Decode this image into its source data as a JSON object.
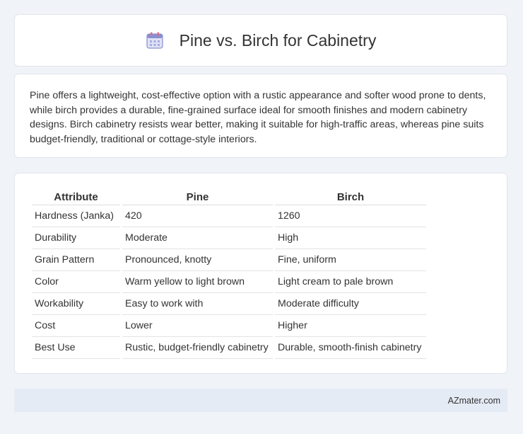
{
  "header": {
    "title": "Pine vs. Birch for Cabinetry",
    "icon": "calendar-icon"
  },
  "description": "Pine offers a lightweight, cost-effective option with a rustic appearance and softer wood prone to dents, while birch provides a durable, fine-grained surface ideal for smooth finishes and modern cabinetry designs. Birch cabinetry resists wear better, making it suitable for high-traffic areas, whereas pine suits budget-friendly, traditional or cottage-style interiors.",
  "table": {
    "headers": [
      "Attribute",
      "Pine",
      "Birch"
    ],
    "rows": [
      [
        "Hardness (Janka)",
        "420",
        "1260"
      ],
      [
        "Durability",
        "Moderate",
        "High"
      ],
      [
        "Grain Pattern",
        "Pronounced, knotty",
        "Fine, uniform"
      ],
      [
        "Color",
        "Warm yellow to light brown",
        "Light cream to pale brown"
      ],
      [
        "Workability",
        "Easy to work with",
        "Moderate difficulty"
      ],
      [
        "Cost",
        "Lower",
        "Higher"
      ],
      [
        "Best Use",
        "Rustic, budget-friendly cabinetry",
        "Durable, smooth-finish cabinetry"
      ]
    ]
  },
  "footer": {
    "source": "AZmater.com"
  }
}
